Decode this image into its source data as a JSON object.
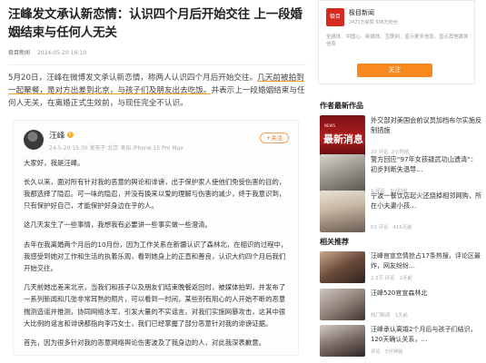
{
  "article": {
    "headline": "汪峰发文承认新恋情：认识四个月后开始交往 上一段婚姻结束与任何人无关",
    "source": "极目新闻",
    "date": "2024-05-20 16:10",
    "intro": [
      "5月20日，汪峰在微博发文承认新恋情，称两人认识四个月后开始交往。",
      "几天前被拍到一起聚餐，是对方出差到北京，与孩子们及朋友出去吃饭。",
      "并表示上一段婚姻结束与任何人无关，在离婚正式生效前，与现任完全不认识。"
    ]
  },
  "weibo": {
    "author": "汪峰",
    "badge": "V",
    "time": "24-5-20 15:30 发布于 北京 来自 iPhone 15 Pro Max",
    "follow_label": "+关注",
    "paragraphs": [
      "大家好，我是汪峰。",
      "长久以来，面对所有针对我的恶意的舆论和诽谤，出于保护家人使他们免受伤害的目的，我都选择了隐忍。可一味的隐忍，并没有换来以爱的理解与伤害的减少，终于我意识到，只有保护好自己，才能保护好身边在乎的人。",
      "这几天发生了一些事情，我想我有必要讲一些事实做一些澄清。",
      "去年在我离婚两个月后的10月份，因为工作关系在新疆认识了森林北，在相识的过程中，我感受到她对工作和生活的执着乐观，看到她身上的正直和善良，认识大约四个月后我们开始交往。",
      "几天前她出差来北京，当我们和孩子以及朋友们结束晚餐返回时，被媒体拍到，并发布了一系列新闻和几张非常耳熟的照片，可以看到一时间，某些别有用心的人开始不断的恶意揣测造谣并推测，协同网络水军，引发大量的不实谣言。对我们实施网暴攻击，这其中很大比例的谣言和诽谤都指向李巧女士，我们已经掌握了部分恶意针对我的诽谤证据。",
      "首先，因为很多针对我的恶意网络舆论伤害波及了我身边的人，对此我深表歉意。"
    ]
  },
  "sidebar": {
    "account": {
      "logo_text": "极目",
      "name": "极目新闻",
      "stats": "2471万获赞 506万粉丝",
      "desc": "全媒体、中国心、新媒体、互联网，显示更多信息，显示其他媒体信息",
      "follow_label": "关注"
    },
    "section1_title": "作者最新作品",
    "section2_title": "相关推荐",
    "latest": [
      {
        "title": "外交部对美国会前议员加档布尔实施反制措施",
        "meta": "20 评论 ·2小时前",
        "thumb_text": "最新消息",
        "thumb_sub": "NEWS"
      },
      {
        "title": "警方回应“97年女孩疑武功山遗清”：初步判断失温导…",
        "meta": "1 评论 · 3小时前"
      },
      {
        "title": "宁波一餐饮店起火还烧掉相邻网购，所在小夫妻小孩…",
        "meta": "53 评论 · 416天前"
      }
    ],
    "related": [
      {
        "title": "汪峰官宣恋情抢占17条热搜，评论区最炸，网友纷纷…",
        "meta": "2.3万 评论 · 2天前"
      },
      {
        "title": "汪峰520官宣森林北",
        "meta": "热门新闻 · 1天前"
      },
      {
        "title": "汪峰承认离婚2个月后与孩子们结识，120天确认关系，…",
        "meta": "评论 · 5分钟前"
      }
    ]
  }
}
